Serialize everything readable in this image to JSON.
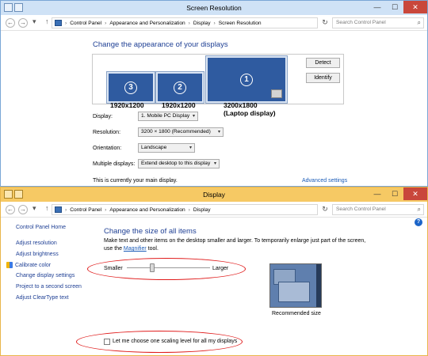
{
  "window1": {
    "title": "Screen Resolution",
    "address": [
      "Control Panel",
      "Appearance and Personalization",
      "Display",
      "Screen Resolution"
    ],
    "search_placeholder": "Search Control Panel",
    "heading": "Change the appearance of your displays",
    "monitors": [
      {
        "number": "3",
        "resolution": "1920x1200"
      },
      {
        "number": "2",
        "resolution": "1920x1200"
      },
      {
        "number": "1",
        "resolution": "3200x1800",
        "resolution_note": "(Laptop display)"
      }
    ],
    "detect_label": "Detect",
    "identify_label": "Identify",
    "display_label": "Display:",
    "display_value": "1. Mobile PC Display",
    "resolution_label": "Resolution:",
    "resolution_value": "3200 × 1800 (Recommended)",
    "orientation_label": "Orientation:",
    "orientation_value": "Landscape",
    "multiple_label": "Multiple displays:",
    "multiple_value": "Extend desktop to this display",
    "advanced_link": "Advanced settings",
    "main_display_text": "This is currently your main display."
  },
  "window2": {
    "title": "Display",
    "address": [
      "Control Panel",
      "Appearance and Personalization",
      "Display"
    ],
    "search_placeholder": "Search Control Panel",
    "sidebar": {
      "home": "Control Panel Home",
      "items": [
        "Adjust resolution",
        "Adjust brightness",
        "Calibrate color",
        "Change display settings",
        "Project to a second screen",
        "Adjust ClearType text"
      ]
    },
    "heading": "Change the size of all items",
    "description_line1": "Make text and other items on the desktop smaller and larger. To temporarily enlarge just part of the screen,",
    "description_line2_prefix": "use the",
    "magnifier_link": "Magnifier",
    "description_line2_suffix": "tool.",
    "slider_min_label": "Smaller",
    "slider_max_label": "Larger",
    "slider_level": 0.3,
    "preview_caption": "Recommended size",
    "checkbox_label": "Let me choose one scaling level for all my displays",
    "checkbox_checked": false
  },
  "colors": {
    "heading_blue": "#1e3f94",
    "link_blue": "#1a5bb7",
    "win1_frame": "#cfe2f6",
    "win2_frame": "#f6c964",
    "annotation_red": "#e01b1b"
  }
}
